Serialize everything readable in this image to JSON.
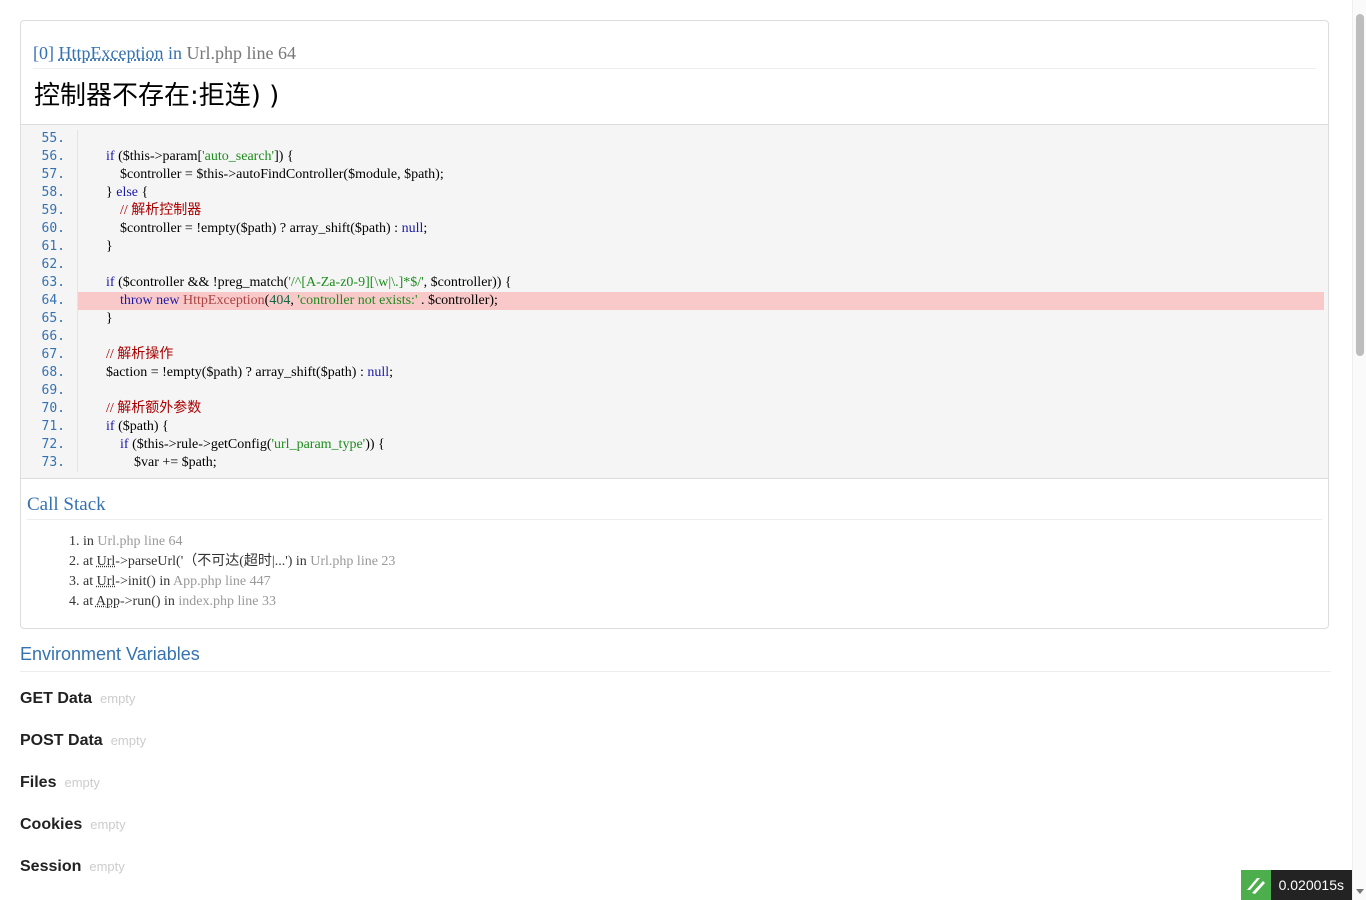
{
  "exception": {
    "index": "[0]",
    "class": "HttpException",
    "in_label": "in",
    "location": "Url.php line 64",
    "message": "控制器不存在:拒连) )"
  },
  "source": {
    "lines": [
      {
        "no": "55.",
        "html": ""
      },
      {
        "no": "56.",
        "html": "        <span class='kw'>if</span> ($this-&gt;param[<span class='str'>'auto_search'</span>]) {"
      },
      {
        "no": "57.",
        "html": "            $controller = $this-&gt;autoFindController($module, $path);"
      },
      {
        "no": "58.",
        "html": "        } <span class='kw'>else</span> {"
      },
      {
        "no": "59.",
        "html": "            <span class='cm'>// 解析控制器</span>"
      },
      {
        "no": "60.",
        "html": "            $controller = !empty($path) ? array_shift($path) : <span class='kw'>null</span>;"
      },
      {
        "no": "61.",
        "html": "        }"
      },
      {
        "no": "62.",
        "html": ""
      },
      {
        "no": "63.",
        "html": "        <span class='kw'>if</span> ($controller &amp;&amp; !preg_match(<span class='str'>'/^[A-Za-z0-9][\\w|\\.]*$/'</span>, $controller)) {"
      },
      {
        "no": "64.",
        "html": "            <span class='kw'>throw new</span> <span class='cls2'>HttpException</span>(<span class='num'>404</span>, <span class='str'>'controller not exists:'</span> . $controller);",
        "highlight": true
      },
      {
        "no": "65.",
        "html": "        }"
      },
      {
        "no": "66.",
        "html": ""
      },
      {
        "no": "67.",
        "html": "        <span class='cm'>// 解析操作</span>"
      },
      {
        "no": "68.",
        "html": "        $action = !empty($path) ? array_shift($path) : <span class='kw'>null</span>;"
      },
      {
        "no": "69.",
        "html": ""
      },
      {
        "no": "70.",
        "html": "        <span class='cm'>// 解析额外参数</span>"
      },
      {
        "no": "71.",
        "html": "        <span class='kw'>if</span> ($path) {"
      },
      {
        "no": "72.",
        "html": "            <span class='kw'>if</span> ($this-&gt;rule-&gt;getConfig(<span class='str'>'url_param_type'</span>)) {"
      },
      {
        "no": "73.",
        "html": "                $var += $path;"
      }
    ]
  },
  "call_stack": {
    "title": "Call Stack",
    "items": [
      {
        "prefix": "in",
        "abbr": "",
        "call": "",
        "loc": "Url.php line 64"
      },
      {
        "prefix": "at",
        "abbr": "Url",
        "call": "->parseUrl('（不可达(超时|...') in",
        "loc": "Url.php line 23"
      },
      {
        "prefix": "at",
        "abbr": "Url",
        "call": "->init() in",
        "loc": "App.php line 447"
      },
      {
        "prefix": "at",
        "abbr": "App",
        "call": "->run() in",
        "loc": "index.php line 33"
      }
    ]
  },
  "environment": {
    "title": "Environment Variables",
    "sections": [
      {
        "name": "GET Data",
        "value": "empty"
      },
      {
        "name": "POST Data",
        "value": "empty"
      },
      {
        "name": "Files",
        "value": "empty"
      },
      {
        "name": "Cookies",
        "value": "empty"
      },
      {
        "name": "Session",
        "value": "empty"
      }
    ]
  },
  "trace_bar": {
    "time": "0.020015s",
    "logo_icon": "thinkphp-logo-icon",
    "logo_color": "#4cae4c"
  }
}
